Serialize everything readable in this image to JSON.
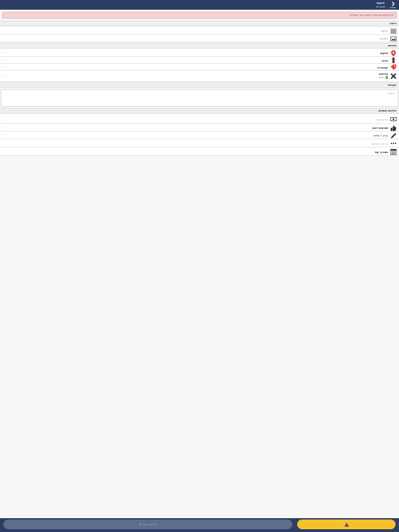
{
  "header": {
    "back_label": "חזרה",
    "title": "דיווח",
    "subtitle": "קטגוריות"
  },
  "alert": {
    "text": "יש להשלים את פרטי הדיווח לפני השליחה"
  },
  "sections": {
    "report": "דיווח",
    "details": "פרטים",
    "notes": "הערות",
    "extra": "פרטים נוספים"
  },
  "report_rows": {
    "barcode": "ברקוד",
    "images": "תמונות"
  },
  "detail_rows": {
    "location": "מיקום",
    "item": "פריט",
    "category": "קטגוריה",
    "priority": "עדיפות",
    "priority_status": "רגילה"
  },
  "notes": {
    "placeholder": "הערות"
  },
  "extra_rows": {
    "amount": "סכום כספי",
    "satisfaction": "שביעות רצון",
    "editor": "עורך / מלווה",
    "more": "פרטים נוספים",
    "date": "תאריך יעד"
  },
  "footer": {
    "send_label": "שליחת דיווח"
  },
  "colors": {
    "header_bg": "#2c3e63",
    "alert_bg": "#f4d3d3",
    "accent_yellow": "#f6c12d",
    "location_red": "#e0453a",
    "category_red": "#e0453a"
  }
}
